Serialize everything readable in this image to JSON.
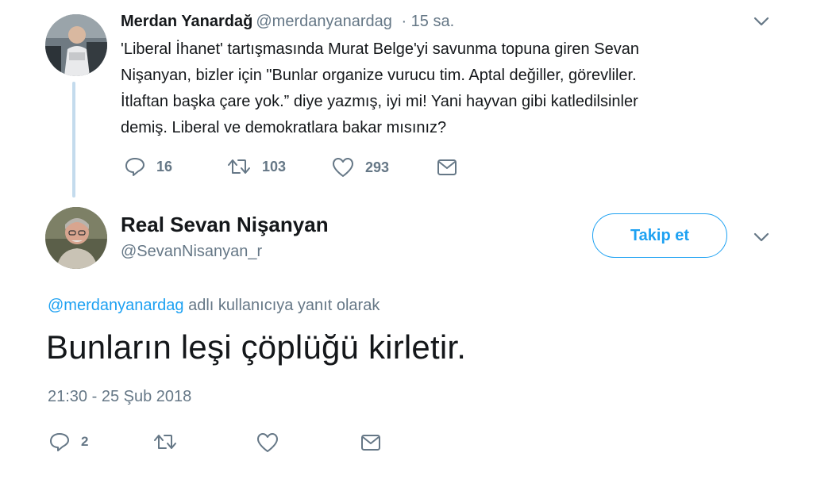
{
  "tweet1": {
    "author_name": "Merdan Yanardağ",
    "author_handle": "@merdanyanardag",
    "time": "· 15 sa.",
    "lines": [
      "'Liberal İhanet' tartışmasında Murat Belge'yi savunma topuna giren Sevan",
      "Nişanyan, bizler için \"Bunlar organize vurucu tim. Aptal değiller, görevliler.",
      "İtlaftan başka çare yok.” diye yazmış, iyi mi! Yani hayvan gibi katledilsinler",
      "demiş. Liberal ve demokratlara bakar mısınız?"
    ],
    "actions": {
      "reply_count": "16",
      "retweet_count": "103",
      "like_count": "293"
    }
  },
  "tweet2": {
    "author_name": "Real Sevan Nişanyan",
    "author_handle": "@SevanNisanyan_r",
    "follow_label": "Takip et",
    "reply_to_handle": "@merdanyanardag",
    "reply_to_suffix": " adlı kullanıcıya yanıt olarak",
    "text": "Bunların leşi çöplüğü kirletir.",
    "timestamp": "21:30 - 25 Şub 2018",
    "actions": {
      "reply_count": "2"
    }
  },
  "colors": {
    "accent": "#1da1f2",
    "muted": "#657786",
    "thread_line": "#c4dbed"
  },
  "icons": [
    "chevron-down-icon",
    "reply-icon",
    "retweet-icon",
    "like-icon",
    "dm-icon"
  ]
}
